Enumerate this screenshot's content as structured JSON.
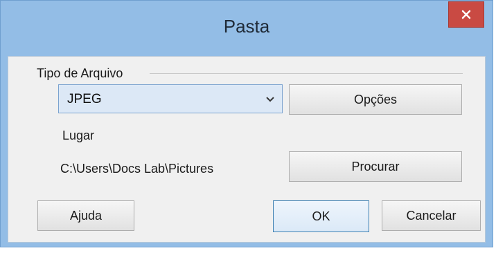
{
  "window": {
    "title": "Pasta",
    "close_icon": "close-icon"
  },
  "file_type": {
    "group_label": "Tipo de Arquivo",
    "selected_value": "JPEG",
    "options_button": "Opções"
  },
  "location": {
    "label": "Lugar",
    "path": "C:\\Users\\Docs Lab\\Pictures",
    "browse_button": "Procurar"
  },
  "footer": {
    "help_button": "Ajuda",
    "ok_button": "OK",
    "cancel_button": "Cancelar"
  },
  "colors": {
    "frame": "#93bde6",
    "close": "#c94a43",
    "client": "#f0f0f0",
    "select_bg": "#dce8f6"
  }
}
